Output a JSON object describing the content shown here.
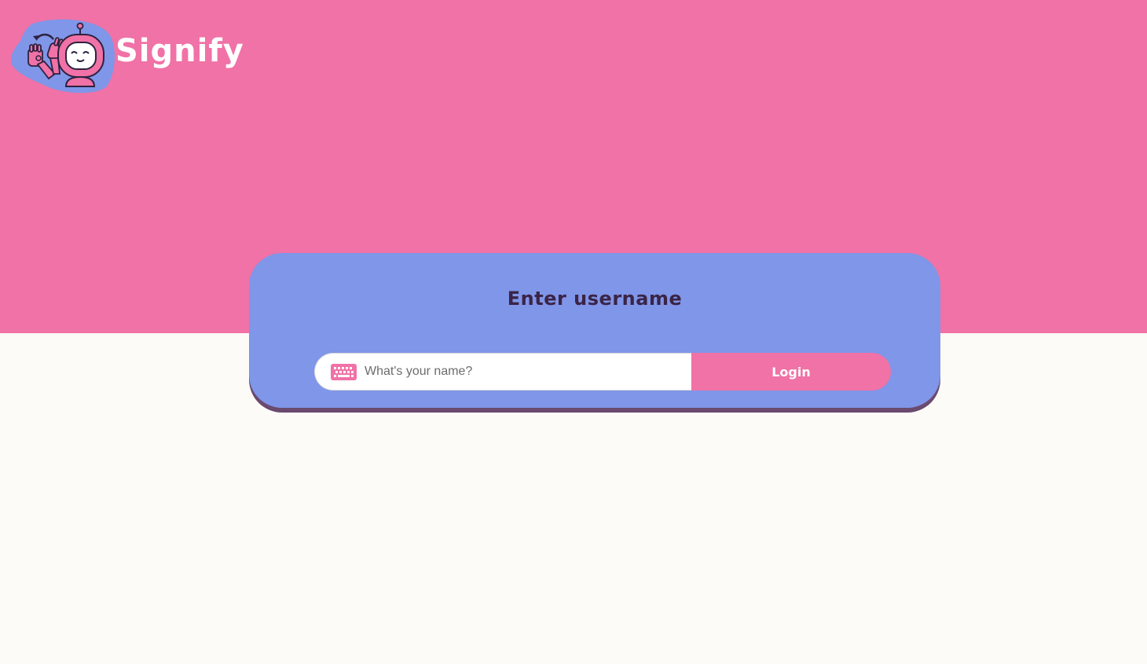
{
  "brand": {
    "name": "Signify",
    "logo_icon": "robot-signing-icon"
  },
  "login": {
    "title": "Enter username",
    "input_placeholder": "What's your name?",
    "input_value": "",
    "input_icon": "keyboard-icon",
    "button_label": "Login"
  },
  "colors": {
    "header_pink": "#f072a6",
    "card_blue": "#7f96e9",
    "card_shadow": "#6a4a6e",
    "page_background": "#fcfbf7",
    "title_text": "#3b2446"
  }
}
